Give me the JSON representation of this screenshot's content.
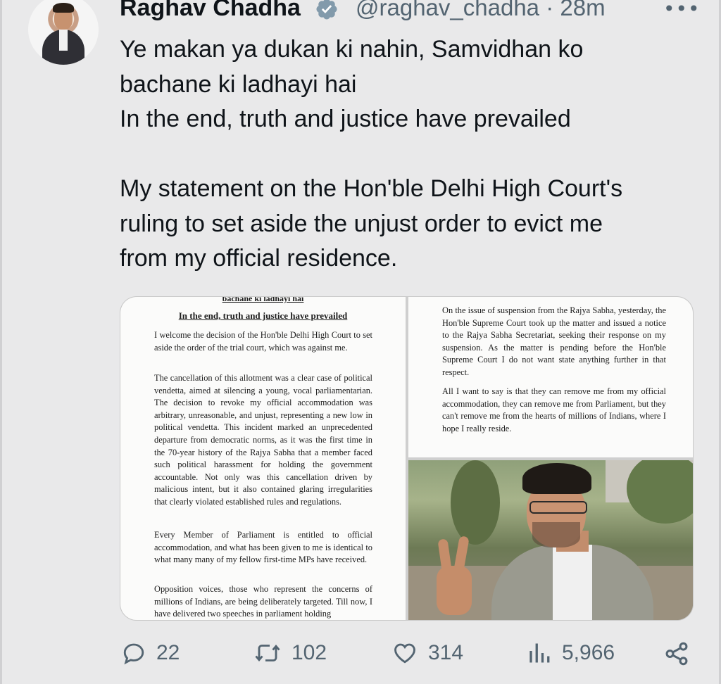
{
  "tweet": {
    "author_name": "Raghav Chadha",
    "handle": "@raghav_chadha",
    "separator": "·",
    "time": "28m",
    "more_label": "•••",
    "lines": [
      "Ye makan ya dukan ki nahin, Samvidhan ko",
      "bachane ki ladhayi hai",
      "In the end, truth and justice have prevailed",
      "",
      "My statement on the Hon'ble Delhi High Court's",
      "ruling to set aside the unjust order to evict me",
      "from my official residence."
    ]
  },
  "media": {
    "left_page": {
      "cut_heading": "bachane ki ladhayi hai",
      "subheading": "In the end, truth and justice have prevailed",
      "paragraphs": [
        "I welcome the decision of the Hon'ble Delhi High Court to set aside the order of the trial court, which was against me.",
        "The cancellation of this allotment was a clear case of political vendetta, aimed at silencing a young, vocal parliamentarian. The decision to revoke my official accommodation was arbitrary, unreasonable, and unjust, representing a new low in political vendetta. This incident marked an unprecedented departure from democratic norms, as it was the first time in the 70-year history of the Rajya Sabha that a member faced such political harassment for holding the government accountable. Not only was this cancellation driven by malicious intent, but it also contained glaring irregularities that clearly violated established rules and regulations.",
        "Every Member of Parliament is entitled to official accommodation, and what has been given to me is identical to what many many of my fellow first-time MPs have received.",
        "Opposition voices, those who represent the concerns of millions of Indians, are being deliberately targeted. Till now, I have delivered two speeches in parliament holding"
      ]
    },
    "right_page": {
      "paragraphs": [
        "On the issue of suspension from the Rajya Sabha, yesterday, the Hon'ble Supreme Court took up the matter and issued a notice to the Rajya Sabha Secretariat, seeking their response on my suspension. As the matter is pending before the Hon'ble Supreme Court I do not want state anything further in that respect.",
        "All I want to say is that they can remove me from my official accommodation, they can remove me from Parliament, but they can't remove me from the hearts of millions of Indians, where I hope I really reside."
      ]
    }
  },
  "actions": {
    "replies": "22",
    "reposts": "102",
    "likes": "314",
    "views": "5,966"
  },
  "colors": {
    "background": "#e9e9ea",
    "text": "#0f1419",
    "secondary": "#536471",
    "verified": "#829aab"
  }
}
